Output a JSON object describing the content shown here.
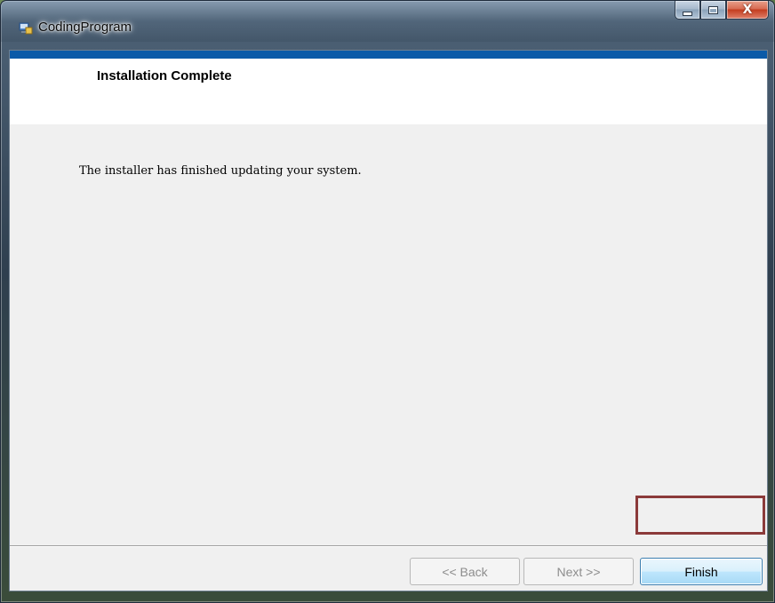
{
  "window": {
    "title": "CodingProgram",
    "close_glyph": "X"
  },
  "header": {
    "title": "Installation Complete"
  },
  "main": {
    "message": "The installer has finished updating your system."
  },
  "buttons": {
    "back_label": "<< Back",
    "next_label": "Next >>",
    "finish_label": "Finish"
  },
  "icons": {
    "app": "installer-app-icon",
    "minimize": "minimize-icon",
    "maximize": "maximize-icon",
    "close": "close-icon"
  },
  "colors": {
    "accent_strip": "#0a5aa8",
    "highlight_border": "#8b3a3a",
    "finish_border": "#3c7fb1"
  }
}
